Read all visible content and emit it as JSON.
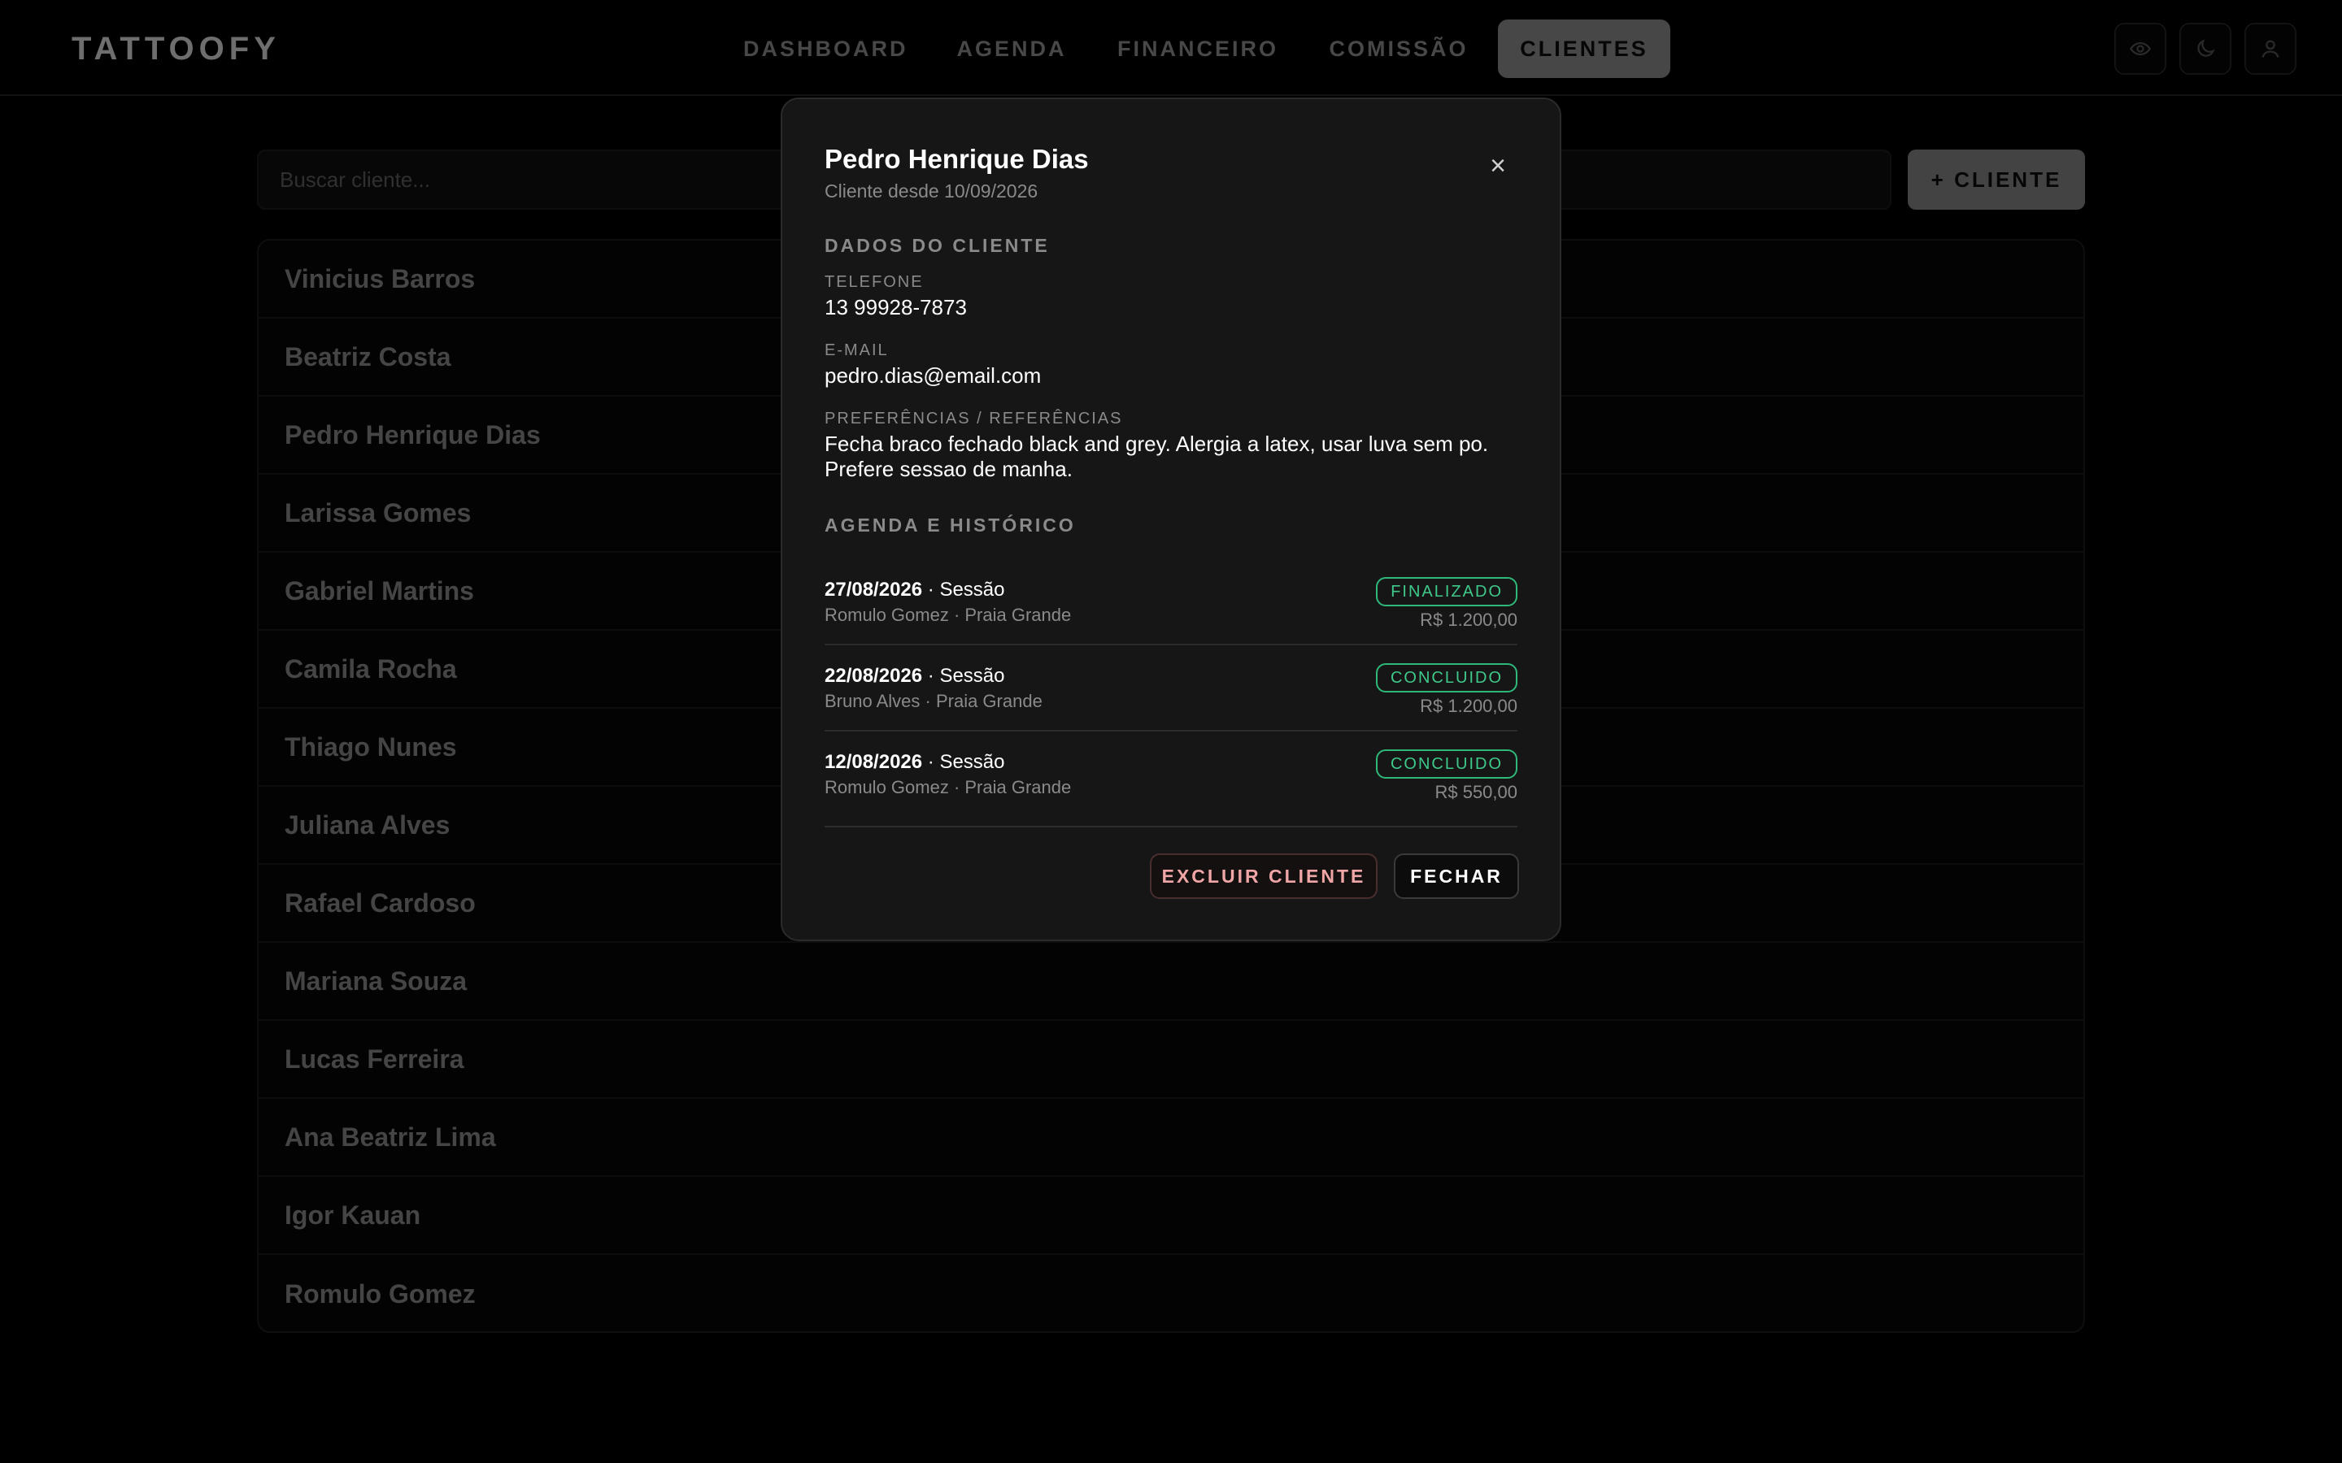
{
  "app": {
    "brand": "TATTOOFY"
  },
  "nav": {
    "items": [
      {
        "label": "DASHBOARD",
        "active": false
      },
      {
        "label": "AGENDA",
        "active": false
      },
      {
        "label": "FINANCEIRO",
        "active": false
      },
      {
        "label": "COMISSÃO",
        "active": false
      },
      {
        "label": "CLIENTES",
        "active": true
      }
    ],
    "icons": [
      "eye-icon",
      "moon-icon",
      "user-icon"
    ]
  },
  "search": {
    "placeholder": "Buscar cliente...",
    "value": ""
  },
  "add_client_label": "+ CLIENTE",
  "clients": [
    "Vinicius Barros",
    "Beatriz Costa",
    "Pedro Henrique Dias",
    "Larissa Gomes",
    "Gabriel Martins",
    "Camila Rocha",
    "Thiago Nunes",
    "Juliana Alves",
    "Rafael Cardoso",
    "Mariana Souza",
    "Lucas Ferreira",
    "Ana Beatriz Lima",
    "Igor Kauan",
    "Romulo Gomez"
  ],
  "modal": {
    "title": "Pedro Henrique Dias",
    "subtitle": "Cliente desde 10/09/2026",
    "close_symbol": "×",
    "section_data": "DADOS DO CLIENTE",
    "phone_label": "TELEFONE",
    "phone": "13 99928-7873",
    "email_label": "E-MAIL",
    "email": "pedro.dias@email.com",
    "prefs_label": "PREFERÊNCIAS / REFERÊNCIAS",
    "prefs": "Fecha braco fechado black and grey. Alergia a latex, usar luva sem po. Prefere sessao de manha.",
    "section_history": "AGENDA E HISTÓRICO",
    "history": [
      {
        "date": "27/08/2026",
        "type": " · Sessão",
        "meta": "Romulo Gomez · Praia Grande",
        "status": "FINALIZADO",
        "price": "R$ 1.200,00"
      },
      {
        "date": "22/08/2026",
        "type": " · Sessão",
        "meta": "Bruno Alves · Praia Grande",
        "status": "CONCLUIDO",
        "price": "R$ 1.200,00"
      },
      {
        "date": "12/08/2026",
        "type": " · Sessão",
        "meta": "Romulo Gomez · Praia Grande",
        "status": "CONCLUIDO",
        "price": "R$ 550,00"
      }
    ],
    "delete_label": "EXCLUIR CLIENTE",
    "close_label": "FECHAR"
  },
  "colors": {
    "background": "#000000",
    "modal_bg": "#161616",
    "status_green": "#3ec98a",
    "danger_text": "#f0a6a6",
    "nav_active_bg": "#6e6e6e"
  }
}
